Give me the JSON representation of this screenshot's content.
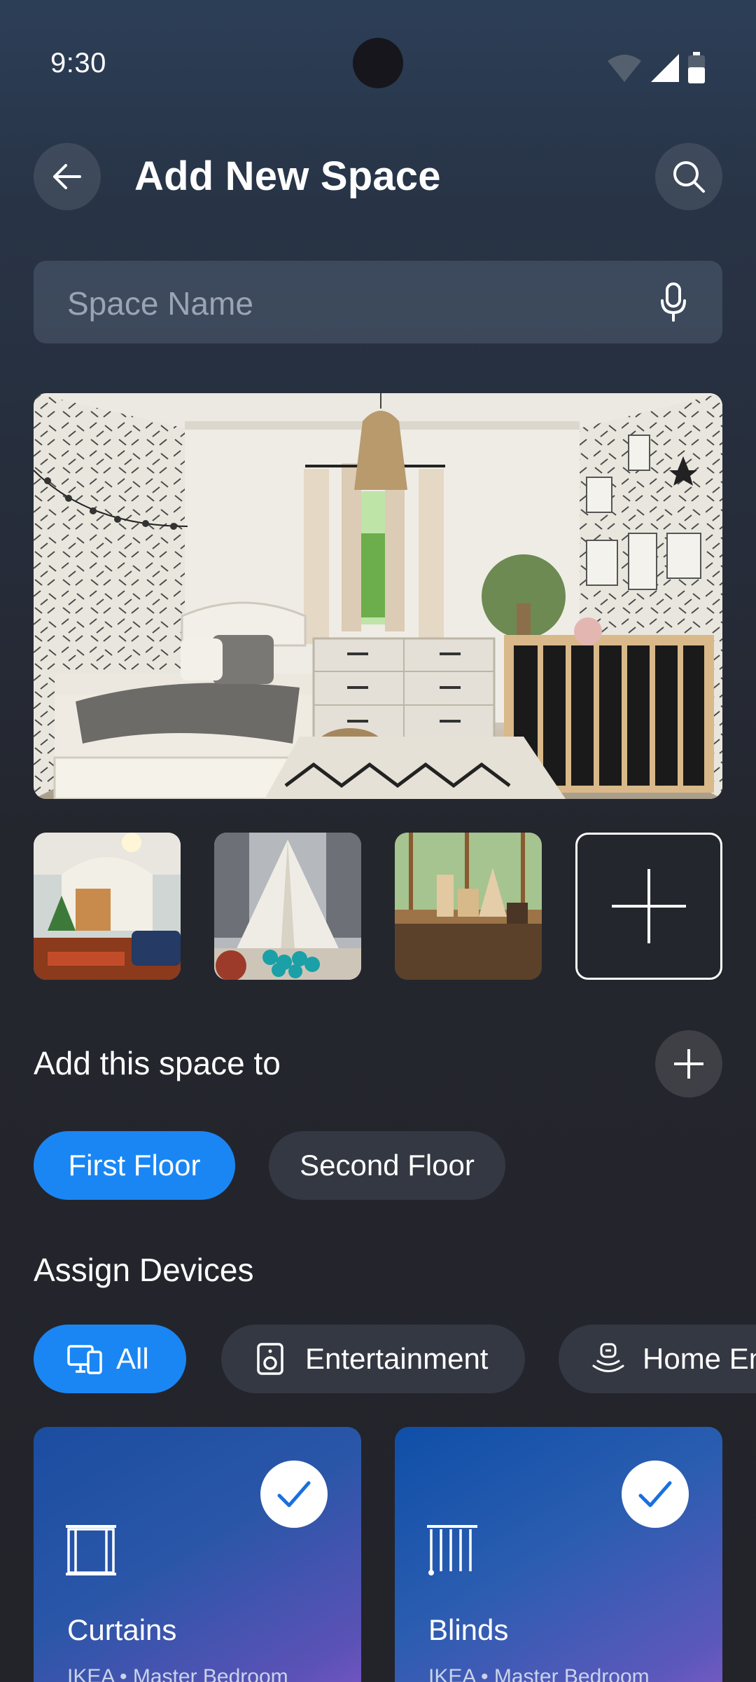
{
  "status_bar": {
    "time": "9:30"
  },
  "header": {
    "title": "Add New Space"
  },
  "space_name": {
    "placeholder": "Space Name"
  },
  "add_space_to": {
    "label": "Add this space to",
    "floors": [
      {
        "label": "First Floor",
        "selected": true
      },
      {
        "label": "Second Floor",
        "selected": false
      }
    ]
  },
  "assign_devices": {
    "label": "Assign Devices",
    "filters": [
      {
        "label": "All",
        "icon": "devices-icon",
        "selected": true
      },
      {
        "label": "Entertainment",
        "icon": "speaker-icon",
        "selected": false
      },
      {
        "label": "Home En",
        "icon": "home-entertainment-icon",
        "selected": false
      }
    ],
    "devices": [
      {
        "name": "Curtains",
        "subtitle": "IKEA • Master Bedroom",
        "icon": "curtains-icon",
        "checked": true
      },
      {
        "name": "Blinds",
        "subtitle": "IKEA • Master Bedroom",
        "icon": "blinds-icon",
        "checked": true
      }
    ]
  },
  "colors": {
    "accent": "#1a86f4",
    "chip_inactive": "#343842",
    "card_gradient_start": "#1d4fa3",
    "card_gradient_end": "#6a4fc0"
  }
}
